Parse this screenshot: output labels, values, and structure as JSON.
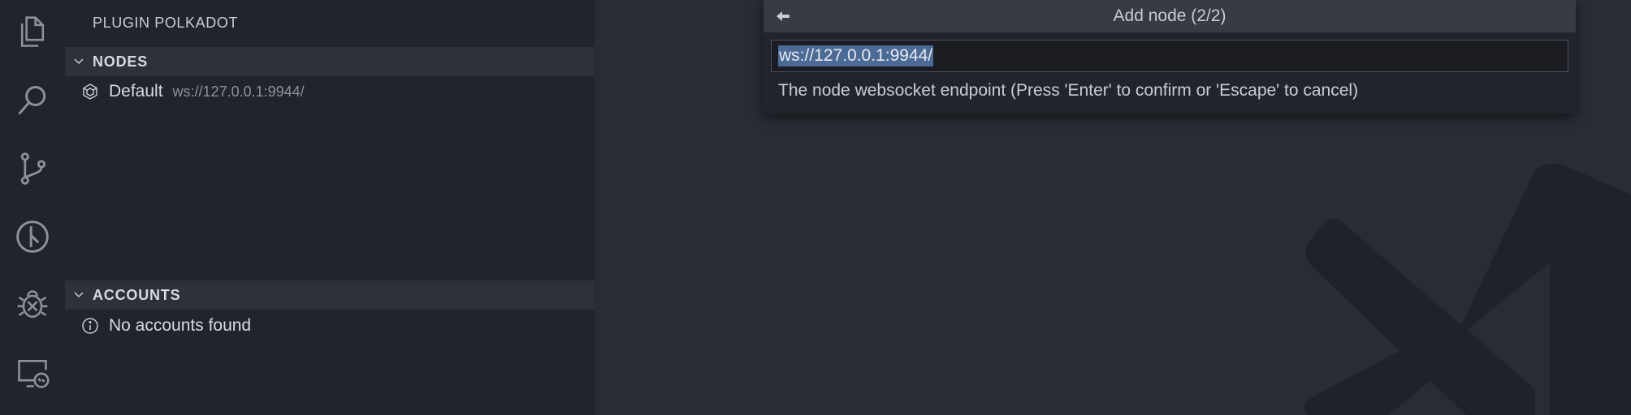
{
  "activity_bar": {
    "icons": [
      "files-icon",
      "search-icon",
      "source-control-icon",
      "polkadot-icon",
      "debug-icon",
      "remote-explorer-icon"
    ]
  },
  "sidebar": {
    "title": "PLUGIN POLKADOT",
    "nodes_section": {
      "label": "NODES",
      "items": [
        {
          "label": "Default",
          "description": "ws://127.0.0.1:9944/",
          "icon": "node-icon"
        }
      ]
    },
    "accounts_section": {
      "label": "ACCOUNTS",
      "items": [
        {
          "label": "No accounts found",
          "icon": "info-icon"
        }
      ]
    }
  },
  "quick_input": {
    "title": "Add node (2/2)",
    "value": "ws://127.0.0.1:9944/",
    "message": "The node websocket endpoint (Press 'Enter' to confirm or 'Escape' to cancel)"
  },
  "colors": {
    "editor_background": "#282c34",
    "sidebar_background": "#21252b",
    "section_header_background": "#2c313a",
    "selection": "#4b6a96"
  }
}
